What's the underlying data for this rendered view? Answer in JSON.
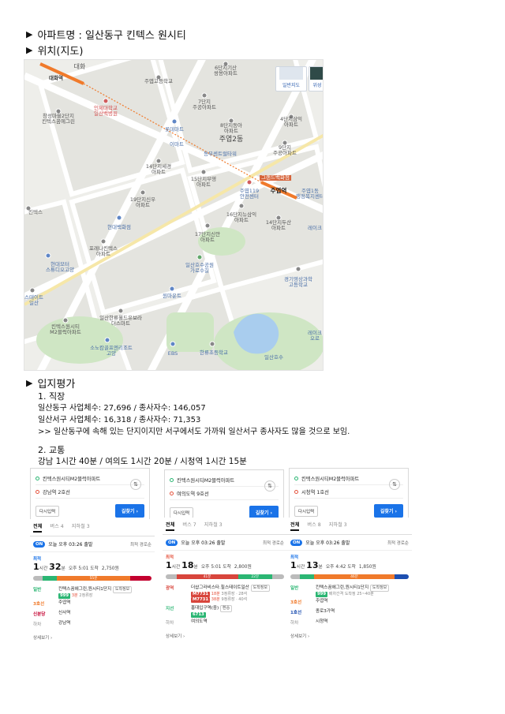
{
  "headings": {
    "apartment": "아파트명 : 일산동구 킨텍스 원시티",
    "location": "위치(지도)",
    "evaluation": "입지평가"
  },
  "map": {
    "buttons": {
      "normal": "일반지도",
      "satellite": "위성"
    },
    "labels": {
      "daehwa": "대화",
      "daehwa_station": "대화역",
      "juyeop_high": "주엽고등학교",
      "apt6": "6단지기산\n쌍용아파트",
      "apt7": "7단지\n주공아파트",
      "inje": "인제대학교\n일산백병원",
      "changseong": "창성마을2단지\n킨텍스꿈에그린",
      "lotte": "롯데마트",
      "apt8": "8단지동아\n아파트",
      "apt4": "4단지삼익\n아파트",
      "emart": "이마트",
      "juyeop2": "주엽2동",
      "dongbu": "동부센트럴타워",
      "apt9": "9단지\n주공아파트",
      "apt14": "14단지세경\n아파트",
      "apt15": "15단지부영\n아파트",
      "juyeop119": "주엽119\n안전센터",
      "juyeop_station": "주엽역",
      "gs": "그랜드백화점",
      "juyeop1": "주엽1동\n행정복지센터",
      "apt19": "19단지신우\n아파트",
      "apt16": "16단지뉴삼익\n아파트",
      "kintex": "킨텍스",
      "apt14b": "14단지두산\n아파트",
      "hyundai": "현대백화점",
      "lake": "레이크",
      "apt17": "17단지신안\n아파트",
      "hyundai_studio": "현대모터\n스튜디오고양",
      "forena": "포레나킨텍스\n아파트",
      "lakepark": "일산호수공원\n가로수길",
      "gyeonggi_hs": "경기영상과학\n고등학교",
      "wondermount": "원마운트",
      "stadium": "스테이트\n일산",
      "ilsan_ebs": "일산한류월드유보라\n더스마트",
      "kintex_m2": "킨텍스원시티\nM2블럭아파트",
      "lake2": "레이크\n오로",
      "sonata": "소노캄골프엔리조트\n고양",
      "ebs": "EBS",
      "hanryu_school": "한류초등학교",
      "ilsan_lake": "일산호수"
    }
  },
  "jobs": {
    "title": "1. 직장",
    "line1": "일산동구 사업체수: 27,696 / 종사자수: 146,057",
    "line2": "일산서구 사업체수: 16,318 / 종사자수: 71,353",
    "line3": ">> 일산동구에 속해 있는 단지이지만 서구에서도 가까워 일산서구 종사자도 많을 것으로 보임."
  },
  "traffic": {
    "title": "2. 교통",
    "summary": "강남 1시간 40분 / 여의도 1시간 20분 / 시청역 1시간 15분"
  },
  "cards": [
    {
      "from": "킨텍스원시티M2블럭아파트",
      "to": "강남역 2호선",
      "retry": "다시입력",
      "go": "길찾기 ›"
    },
    {
      "from": "킨텍스원시티M2블럭아파트",
      "to": "여의도역 9호선",
      "retry": "다시입력",
      "go": "길찾기 ›"
    },
    {
      "from": "킨텍스원시티M2블럭아파트",
      "to": "시청역 1호선",
      "retry": "다시입력",
      "go": "길찾기 ›"
    }
  ],
  "results": [
    {
      "tabs": [
        "전체",
        "버스 4",
        "지하철 3"
      ],
      "on": "ON",
      "time": "오늘 오후 03:26 출발",
      "sort": "최적 경로순",
      "best": "최적",
      "duration_h": "1",
      "duration_m": "32",
      "arrive": "오후 5:01 도착",
      "fare": "2,750원",
      "bar_labels": [
        "5분",
        "7분",
        "55분",
        "6분"
      ],
      "steps": [
        {
          "lbl": "일반",
          "val": "킨텍스꿈에그린,원시티1단지",
          "chip": "도착정보",
          "bus": "999",
          "sub": "3분",
          "subgray": "2정류장"
        },
        {
          "lbl": "3호선",
          "val": "주엽역"
        },
        {
          "lbl": "신분당",
          "val": "신사역"
        },
        {
          "lbl": "하차",
          "val": "강남역"
        }
      ],
      "detail": "상세보기 ›"
    },
    {
      "tabs": [
        "전체",
        "버스 7",
        "지하철 3"
      ],
      "on": "ON",
      "time": "오늘 오후 03:26 출발",
      "sort": "최적 경로순",
      "best": "최적",
      "duration_h": "1",
      "duration_m": "18",
      "arrive": "오후 5:01 도착",
      "fare": "2,800원",
      "bar_labels": [
        "6분",
        "41분",
        "22분",
        "6분"
      ],
      "steps": [
        {
          "lbl": "광역",
          "val": "더샵그라비스타.힐스테이트일산",
          "chip": "도착정보",
          "bus": "M7731",
          "sub": "18분",
          "subgray": "3정류장 · 28석",
          "bus2": "M7731",
          "sub2": "38분",
          "subgray2": "9정류장 · 40석"
        },
        {
          "lbl": "지선",
          "val": "홍대입구역(중)",
          "chip": "환승",
          "bus": "6713"
        },
        {
          "lbl": "하차",
          "val": "여의도역"
        }
      ],
      "detail": "상세보기 ›"
    },
    {
      "tabs": [
        "전체",
        "버스 8",
        "지하철 3"
      ],
      "on": "ON",
      "time": "오늘 오후 03:26 출발",
      "sort": "최적 경로순",
      "best": "최적",
      "duration_h": "1",
      "duration_m": "13",
      "arrive": "오후 4:42 도착",
      "fare": "1,850원",
      "bar_labels": [
        "5분",
        "7분",
        "46분",
        "4분"
      ],
      "steps": [
        {
          "lbl": "일반",
          "val": "킨텍스꿈에그린,원시티1단지",
          "chip": "도착정보",
          "bus": "999",
          "sub": "",
          "subgray": "배차간격 도착정 25~40분"
        },
        {
          "lbl": "3호선",
          "val": "주엽역"
        },
        {
          "lbl": "1호선",
          "val": "종로3가역"
        },
        {
          "lbl": "하차",
          "val": "시청역"
        }
      ],
      "detail": "상세보기 ›"
    }
  ]
}
